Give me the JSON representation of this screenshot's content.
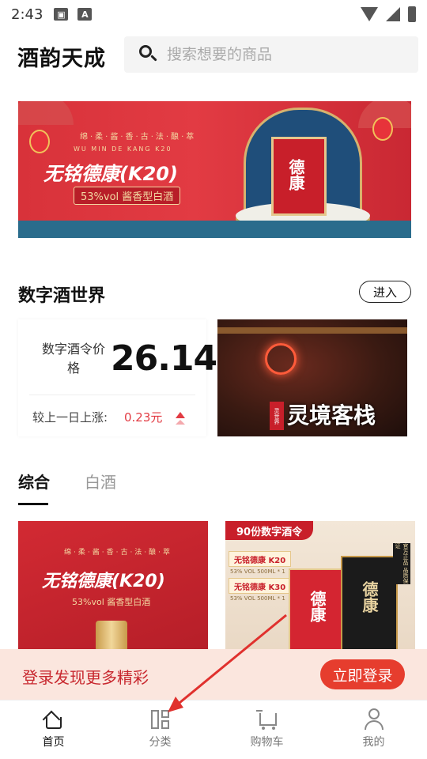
{
  "status_bar": {
    "time": "2:43",
    "icons": [
      "image-icon",
      "text-a-icon",
      "wifi-icon",
      "signal-icon",
      "battery-charging-icon"
    ]
  },
  "header": {
    "title": "酒韵天成",
    "search_placeholder": "搜索想要的商品"
  },
  "banner": {
    "tagline": "绵·柔·酱·香·古·法·酿·萃",
    "pinyin": "WU   MIN   DE   KANG   K20",
    "title": "无铭德康(K20)",
    "subtitle": "53%vol 酱香型白酒",
    "box_text": "德康"
  },
  "digital_section": {
    "title": "数字酒世界",
    "enter_label": "进入",
    "price_label": "数字酒令价格",
    "price_value": "26.14",
    "change_label": "较上一日上涨:",
    "change_value": "0.23元",
    "image_title": "灵境客栈",
    "image_seal": "灵世界"
  },
  "tabs": [
    {
      "label": "综合",
      "active": true
    },
    {
      "label": "白酒",
      "active": false
    }
  ],
  "products": [
    {
      "tagline": "绵·柔·酱·香·古·法·酿·萃",
      "title": "无铭德康(K20)",
      "subtitle": "53%vol 酱香型白酒"
    },
    {
      "ribbon": "90份数字酒令",
      "pill1": "无铭德康 K20",
      "spec1": "53% VOL 500ML * 1",
      "pill2": "无铭德康 K30",
      "spec2": "53% VOL 500ML * 1",
      "box1": "德康",
      "box2": "德康",
      "badge": "官方正品 品质保证"
    }
  ],
  "login_bar": {
    "text": "登录发现更多精彩",
    "button": "立即登录"
  },
  "tabbar": [
    {
      "label": "首页",
      "icon": "home-icon",
      "active": true
    },
    {
      "label": "分类",
      "icon": "category-icon",
      "active": false
    },
    {
      "label": "购物车",
      "icon": "cart-icon",
      "active": false
    },
    {
      "label": "我的",
      "icon": "profile-icon",
      "active": false
    }
  ],
  "colors": {
    "accent": "#e63d2e",
    "price_up": "#e23b43",
    "login_bar_bg": "#fbe6de",
    "banner_red": "#d8323a"
  }
}
